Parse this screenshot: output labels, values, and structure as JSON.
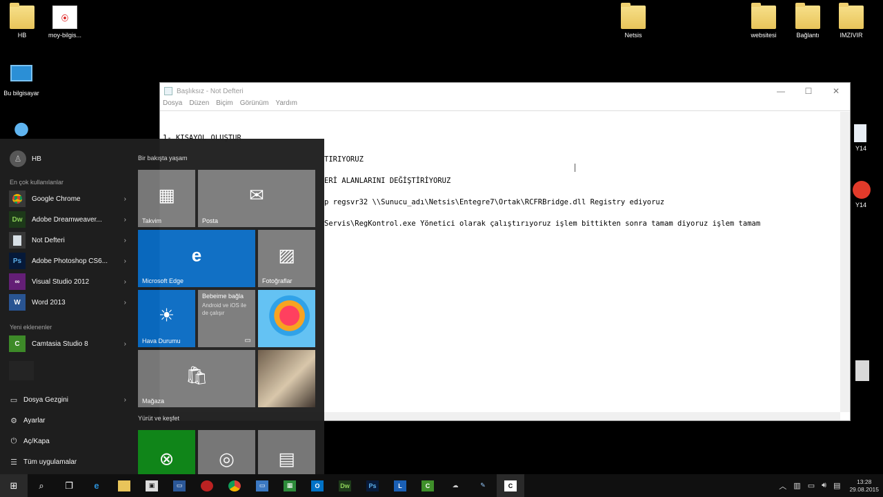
{
  "desktop": {
    "icons": [
      {
        "label": "HB"
      },
      {
        "label": "moy-bilgis..."
      },
      {
        "label": "Bu bilgisayar"
      },
      {
        "label": "Netsis"
      },
      {
        "label": "websitesi"
      },
      {
        "label": "Bağlantı"
      },
      {
        "label": "IMZIVIR"
      },
      {
        "label": "Y14"
      },
      {
        "label": "Y14"
      }
    ]
  },
  "notepad": {
    "title": "Başlıksız - Not Defteri",
    "menu": [
      "Dosya",
      "Düzen",
      "Biçim",
      "Görünüm",
      "Yardım"
    ],
    "lines": [
      "1- KISAYOL OLUŞTUR",
      "TIRIYORUZ",
      "ERİ ALANLARINI DEĞİŞTİRİYORUZ",
      "p regsvr32 \\\\Sunucu_adı\\Netsis\\Entegre7\\Ortak\\RCFRBridge.dll Registry ediyoruz",
      "Servis\\RegKontrol.exe Yönetici olarak çalıştırıyoruz işlem bittikten sonra tamam diyoruz işlem tamam"
    ]
  },
  "startmenu": {
    "user": "HB",
    "most_used_title": "En çok kullanılanlar",
    "apps": [
      {
        "label": "Google Chrome",
        "color": "#3a3a3a"
      },
      {
        "label": "Adobe Dreamweaver...",
        "color": "#1e3b1a"
      },
      {
        "label": "Not Defteri",
        "color": "#3a3a3a"
      },
      {
        "label": "Adobe Photoshop CS6...",
        "color": "#071a3a"
      },
      {
        "label": "Visual Studio 2012",
        "color": "#68217a"
      },
      {
        "label": "Word 2013",
        "color": "#2b5797"
      }
    ],
    "recent_title": "Yeni eklenenler",
    "recent_app": {
      "label": "Camtasia Studio 8"
    },
    "system": [
      {
        "label": "Dosya Gezgini",
        "icon": "folder-icon"
      },
      {
        "label": "Ayarlar",
        "icon": "gear-icon"
      },
      {
        "label": "Aç/Kapa",
        "icon": "power-icon"
      },
      {
        "label": "Tüm uygulamalar",
        "icon": "list-icon"
      }
    ],
    "group1_title": "Bir bakışta yaşam",
    "group2_title": "Yürüt ve keşfet",
    "tiles": {
      "calendar": "Takvim",
      "mail": "Posta",
      "edge": "Microsoft Edge",
      "photos": "Fotoğraflar",
      "weather": "Hava Durumu",
      "phone_title": "Bebeime bağla",
      "phone_desc": "Android ve iOS ile de çalışır",
      "store": "Mağaza"
    }
  },
  "taskbar": {
    "clock_time": "13:28",
    "clock_date": "29.08.2015"
  }
}
